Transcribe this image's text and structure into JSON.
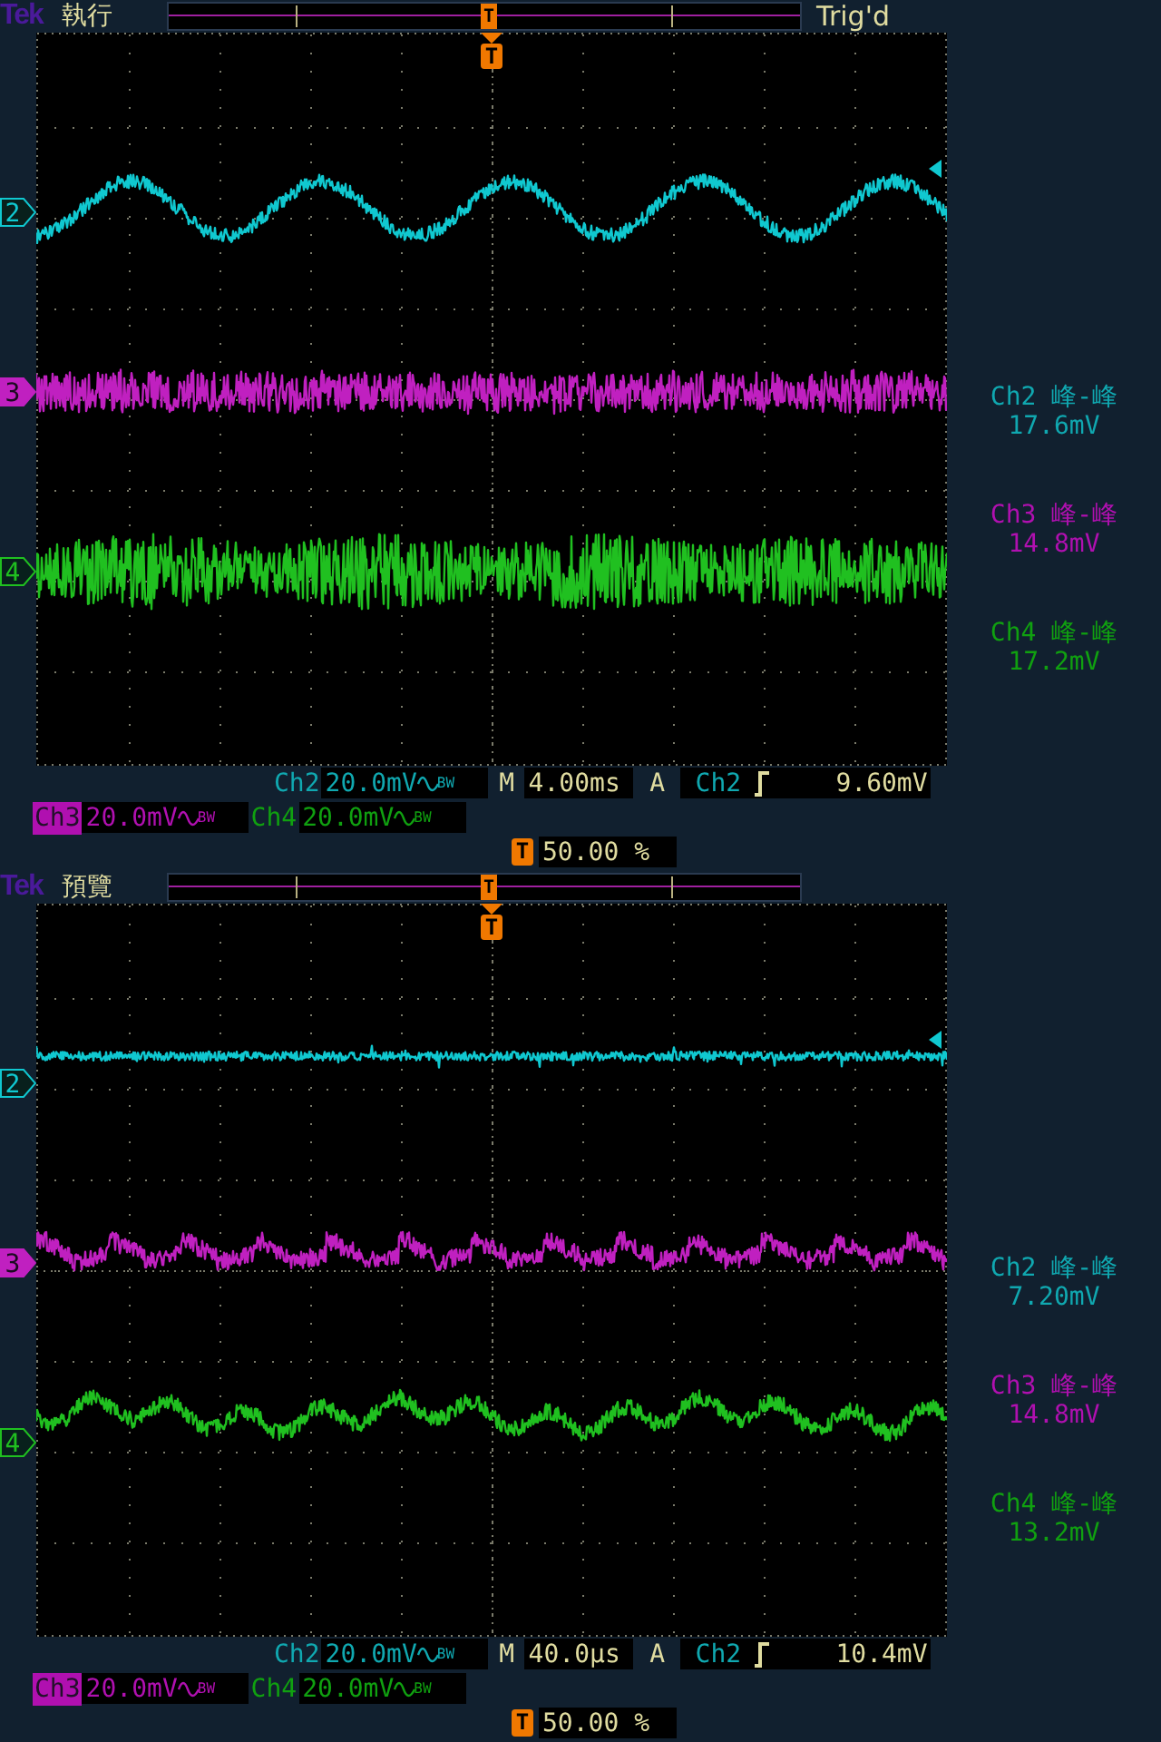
{
  "screens": [
    {
      "brand": "Tek",
      "status": "執行",
      "trigger_state": "Trig'd",
      "record_marker": "T",
      "top_marker": "T",
      "channels": [
        {
          "number": "2",
          "color": "#10c8d0",
          "selected": false,
          "kind": "sine"
        },
        {
          "number": "3",
          "color": "#c020c0",
          "selected": true,
          "kind": "noise"
        },
        {
          "number": "4",
          "color": "#20c020",
          "selected": false,
          "kind": "burst"
        }
      ],
      "measurements": [
        {
          "label": "Ch2 峰-峰",
          "value": "17.6mV",
          "color": "#10a8b0"
        },
        {
          "label": "Ch3 峰-峰",
          "value": "14.8mV",
          "color": "#b010b0"
        },
        {
          "label": "Ch4 峰-峰",
          "value": "17.2mV",
          "color": "#10a010"
        }
      ],
      "vertical": [
        {
          "channel": "Ch2",
          "scale": "20.0mV",
          "bw": "BW",
          "color": "#10a8b0",
          "selected": false
        },
        {
          "channel": "Ch3",
          "scale": "20.0mV",
          "bw": "BW",
          "color": "#b010b0",
          "selected": true
        },
        {
          "channel": "Ch4",
          "scale": "20.0mV",
          "bw": "BW",
          "color": "#10a010",
          "selected": false
        }
      ],
      "timebase": {
        "label": "M",
        "value": "4.00ms"
      },
      "trigger": {
        "label": "A",
        "source": "Ch2",
        "level": "9.60mV"
      },
      "position": {
        "marker": "T",
        "value": "50.00 %"
      }
    },
    {
      "brand": "Tek",
      "status": "預覽",
      "record_marker": "T",
      "top_marker": "T",
      "channels": [
        {
          "number": "2",
          "color": "#10c8d0",
          "selected": false,
          "kind": "flat"
        },
        {
          "number": "3",
          "color": "#c020c0",
          "selected": true,
          "kind": "ripple"
        },
        {
          "number": "4",
          "color": "#20c020",
          "selected": false,
          "kind": "wavy"
        }
      ],
      "measurements": [
        {
          "label": "Ch2 峰-峰",
          "value": "7.20mV",
          "color": "#10a8b0"
        },
        {
          "label": "Ch3 峰-峰",
          "value": "14.8mV",
          "color": "#b010b0"
        },
        {
          "label": "Ch4 峰-峰",
          "value": "13.2mV",
          "color": "#10a010"
        }
      ],
      "vertical": [
        {
          "channel": "Ch2",
          "scale": "20.0mV",
          "bw": "BW",
          "color": "#10a8b0",
          "selected": false
        },
        {
          "channel": "Ch3",
          "scale": "20.0mV",
          "bw": "BW",
          "color": "#b010b0",
          "selected": true
        },
        {
          "channel": "Ch4",
          "scale": "20.0mV",
          "bw": "BW",
          "color": "#10a010",
          "selected": false
        }
      ],
      "timebase": {
        "label": "M",
        "value": "40.0µs"
      },
      "trigger": {
        "label": "A",
        "source": "Ch2",
        "level": "10.4mV"
      },
      "position": {
        "marker": "T",
        "value": "50.00 %"
      }
    }
  ]
}
